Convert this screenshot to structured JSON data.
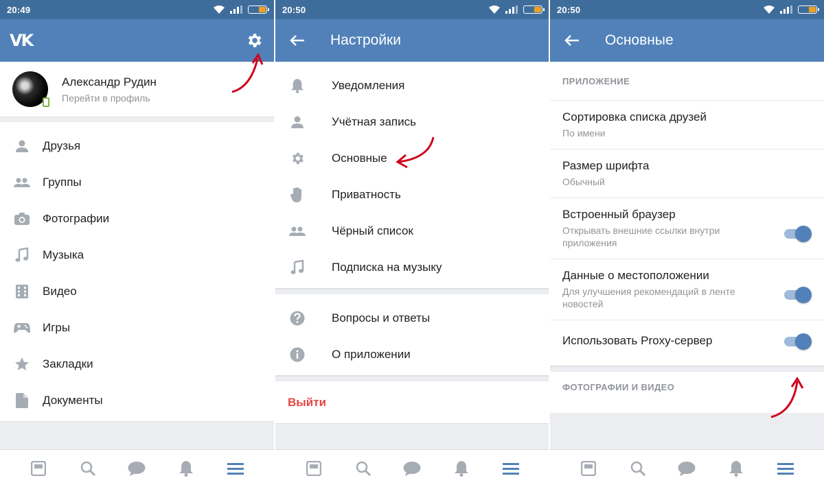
{
  "panels": [
    {
      "status_time": "20:49",
      "logo": "VK",
      "profile": {
        "name": "Александр Рудин",
        "subtitle": "Перейти в профиль"
      },
      "menu": [
        {
          "label": "Друзья",
          "icon": "person-icon"
        },
        {
          "label": "Группы",
          "icon": "people-icon"
        },
        {
          "label": "Фотографии",
          "icon": "camera-icon"
        },
        {
          "label": "Музыка",
          "icon": "music-note-icon"
        },
        {
          "label": "Видео",
          "icon": "film-icon"
        },
        {
          "label": "Игры",
          "icon": "gamepad-icon"
        },
        {
          "label": "Закладки",
          "icon": "star-icon"
        },
        {
          "label": "Документы",
          "icon": "document-icon"
        }
      ]
    },
    {
      "status_time": "20:50",
      "title": "Настройки",
      "menu": [
        {
          "label": "Уведомления",
          "icon": "bell-icon"
        },
        {
          "label": "Учётная запись",
          "icon": "person-icon"
        },
        {
          "label": "Основные",
          "icon": "gear-icon"
        },
        {
          "label": "Приватность",
          "icon": "hand-icon"
        },
        {
          "label": "Чёрный список",
          "icon": "people-icon"
        },
        {
          "label": "Подписка на музыку",
          "icon": "music-note-icon"
        }
      ],
      "menu2": [
        {
          "label": "Вопросы и ответы",
          "icon": "question-icon"
        },
        {
          "label": "О приложении",
          "icon": "info-icon"
        }
      ],
      "logout": "Выйти"
    },
    {
      "status_time": "20:50",
      "title": "Основные",
      "section1": "ПРИЛОЖЕНИЕ",
      "settings": [
        {
          "title": "Сортировка списка друзей",
          "desc": "По имени",
          "toggle": null
        },
        {
          "title": "Размер шрифта",
          "desc": "Обычный",
          "toggle": null
        },
        {
          "title": "Встроенный браузер",
          "desc": "Открывать внешние ссылки внутри приложения",
          "toggle": true
        },
        {
          "title": "Данные о местоположении",
          "desc": "Для улучшения рекомендаций в ленте новостей",
          "toggle": true
        },
        {
          "title": "Использовать Proxy-сервер",
          "desc": "",
          "toggle": true
        }
      ],
      "section2": "ФОТОГРАФИИ И ВИДЕО"
    }
  ],
  "colors": {
    "status_bar": "#3f6d9b",
    "app_bar": "#5181b8",
    "accent": "#5181b8",
    "logout": "#e64646",
    "arrow": "#d0021b"
  },
  "nav_icons": [
    "news-icon",
    "search-icon",
    "messages-icon",
    "notifications-icon",
    "menu-icon"
  ]
}
